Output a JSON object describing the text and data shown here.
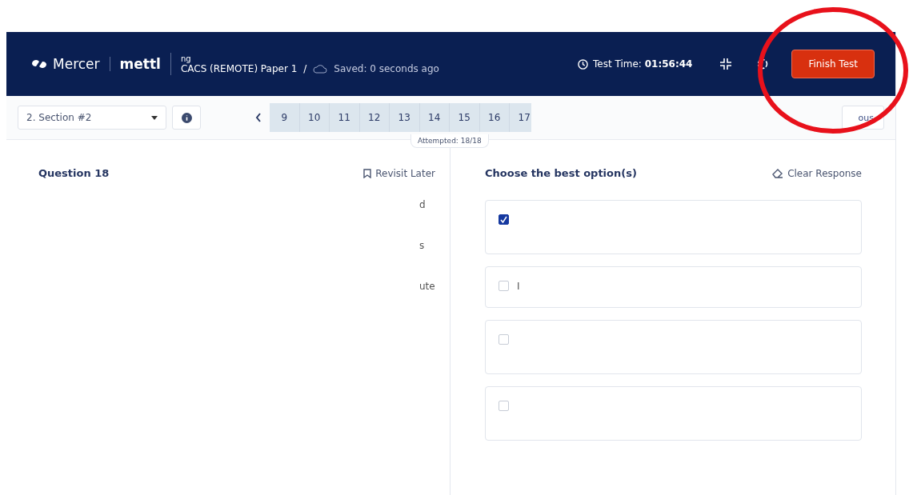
{
  "header": {
    "brand": "Mercer",
    "product": "mettl",
    "user": "ng",
    "test_name": "CACS (REMOTE) Paper 1",
    "separator": "/",
    "saved": "Saved: 0 seconds ago",
    "timer_label": "Test Time:",
    "timer_value": "01:56:44",
    "finish_button": "Finish Test"
  },
  "toolbar": {
    "section": "2. Section #2",
    "questions": [
      {
        "label": "9",
        "selected": false
      },
      {
        "label": "10",
        "selected": false
      },
      {
        "label": "11",
        "selected": false
      },
      {
        "label": "12",
        "selected": false
      },
      {
        "label": "13",
        "selected": false
      },
      {
        "label": "14",
        "selected": false
      },
      {
        "label": "15",
        "selected": false
      },
      {
        "label": "16",
        "selected": false
      },
      {
        "label": "17",
        "selected": false
      }
    ],
    "attempted": "Attempted: 18/18",
    "nav_button": "ous"
  },
  "question": {
    "title": "Question 18",
    "revisit": "Revisit Later",
    "fragments": [
      "d",
      "s",
      "ute"
    ]
  },
  "answers": {
    "title": "Choose the best option(s)",
    "clear": "Clear Response",
    "options": [
      {
        "checked": true
      },
      {
        "checked": false,
        "text": "I"
      },
      {
        "checked": false
      },
      {
        "checked": false
      }
    ]
  },
  "annotation": {
    "kind": "circle",
    "color": "#e8111b"
  }
}
